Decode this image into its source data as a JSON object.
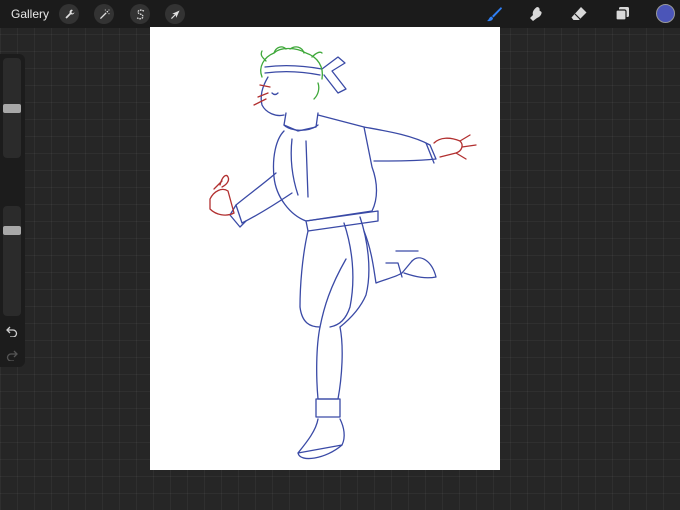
{
  "topbar": {
    "gallery_label": "Gallery",
    "left_tools": [
      {
        "name": "actions",
        "icon": "wrench-icon"
      },
      {
        "name": "adjustments",
        "icon": "magic-wand-icon"
      },
      {
        "name": "selection",
        "icon": "selection-s-icon"
      },
      {
        "name": "transform",
        "icon": "arrow-cursor-icon"
      }
    ],
    "right_tools": [
      {
        "name": "brush",
        "icon": "brush-icon",
        "active": true
      },
      {
        "name": "smudge",
        "icon": "smudge-finger-icon",
        "active": false
      },
      {
        "name": "eraser",
        "icon": "eraser-icon",
        "active": false
      },
      {
        "name": "layers",
        "icon": "layers-icon",
        "active": false
      }
    ],
    "current_color": "#4b55b8",
    "active_tool_color": "#2f7ff5"
  },
  "sidebar": {
    "brush_size_level": 0.5,
    "opacity_level": 0.2,
    "modify_button_icon": "square-icon",
    "undo_icon": "undo-icon",
    "redo_icon": "redo-icon"
  },
  "canvas": {
    "background": "#ffffff",
    "stroke_colors": {
      "body": "#3a4aa6",
      "hair": "#3fa83a",
      "hands": "#b23030"
    }
  }
}
